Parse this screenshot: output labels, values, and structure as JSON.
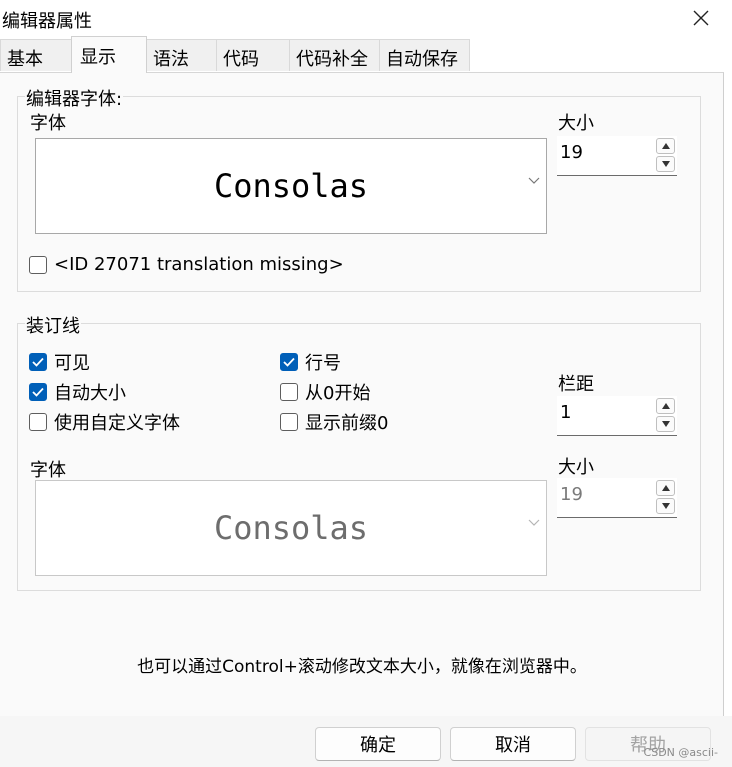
{
  "window": {
    "title": "编辑器属性"
  },
  "tabs": [
    {
      "label": "基本",
      "active": false
    },
    {
      "label": "显示",
      "active": true
    },
    {
      "label": "语法",
      "active": false
    },
    {
      "label": "代码",
      "active": false
    },
    {
      "label": "代码补全",
      "active": false
    },
    {
      "label": "自动保存",
      "active": false
    }
  ],
  "editor_font": {
    "group_title": "编辑器字体:",
    "font_label": "字体",
    "font_value": "Consolas",
    "size_label": "大小",
    "size_value": "19",
    "checkbox": {
      "label": "<ID 27071 translation missing>",
      "checked": false
    }
  },
  "gutter": {
    "group_title": "装订线",
    "options": [
      {
        "label": "可见",
        "checked": true
      },
      {
        "label": "行号",
        "checked": true
      },
      {
        "label": "自动大小",
        "checked": true
      },
      {
        "label": "从0开始",
        "checked": false
      },
      {
        "label": "使用自定义字体",
        "checked": false
      },
      {
        "label": "显示前缀0",
        "checked": false
      }
    ],
    "spacing_label": "栏距",
    "spacing_value": "1",
    "font_label": "字体",
    "font_value": "Consolas",
    "size_label": "大小",
    "size_value": "19"
  },
  "tip": "也可以通过Control+滚动修改文本大小，就像在浏览器中。",
  "buttons": {
    "ok": "确定",
    "cancel": "取消",
    "help": "帮助"
  },
  "watermark": "CSDN @ascii-",
  "colors": {
    "accent": "#005fb8"
  }
}
